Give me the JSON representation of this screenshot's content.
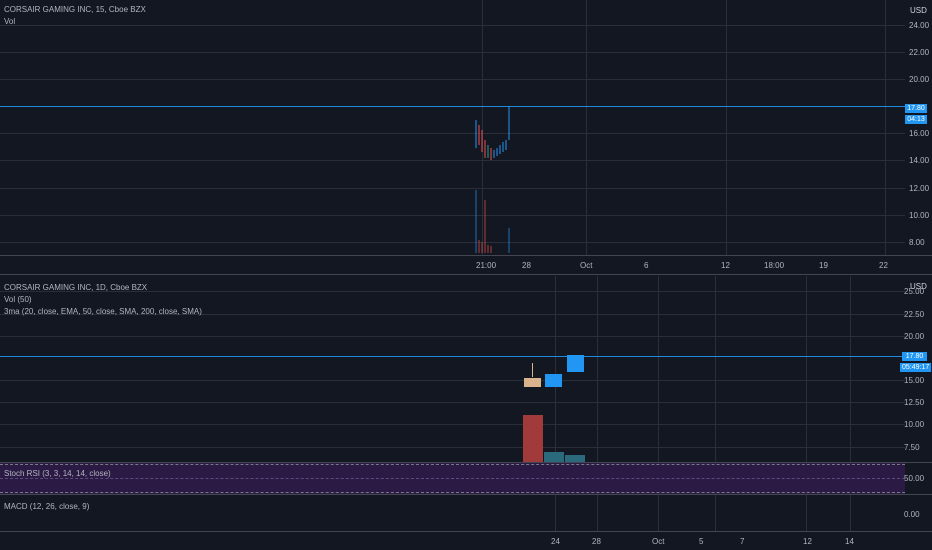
{
  "top_chart": {
    "title": "CORSAIR GAMING INC, 15, Cboe BZX",
    "vol_label": "Vol",
    "currency": "USD",
    "y_ticks": [
      "24.00",
      "22.00",
      "20.00",
      "16.00",
      "14.00",
      "12.00",
      "10.00",
      "8.00"
    ],
    "price_tag": "17.80",
    "countdown_tag": "04:13",
    "x_ticks": [
      "21:00",
      "28",
      "Oct",
      "6",
      "12",
      "18:00",
      "19",
      "22"
    ]
  },
  "bottom_chart": {
    "title": "CORSAIR GAMING INC, 1D, Cboe BZX",
    "vol_label": "Vol (50)",
    "ma_label": "3ma (20, close, EMA, 50, close, SMA, 200, close, SMA)",
    "currency": "USD",
    "y_ticks": [
      "25.00",
      "22.50",
      "20.00",
      "15.00",
      "12.50",
      "10.00",
      "7.50"
    ],
    "price_tag": "17.80",
    "countdown_tag": "05:49:17"
  },
  "stoch_rsi": {
    "label": "Stoch RSI (3, 3, 14, 14, close)",
    "y_tick": "50.00"
  },
  "macd": {
    "label": "MACD (12, 26, close, 9)",
    "y_tick": "0.00"
  },
  "bottom_x_ticks": [
    "24",
    "28",
    "Oct",
    "5",
    "7",
    "12",
    "14"
  ],
  "colors": {
    "background": "#131722",
    "grid": "#2a2e39",
    "accent": "#2196f3",
    "up": "#26a69a",
    "down": "#ef5350",
    "stoch_band": "#2a1a44"
  }
}
